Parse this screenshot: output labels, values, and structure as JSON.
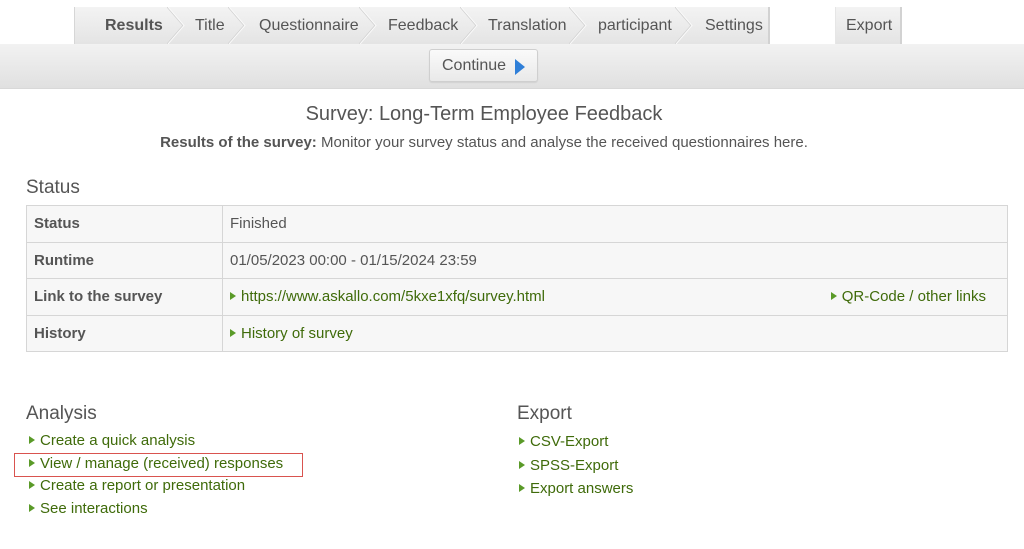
{
  "tabs": [
    {
      "label": "Results",
      "active": true
    },
    {
      "label": "Title"
    },
    {
      "label": "Questionnaire"
    },
    {
      "label": "Feedback"
    },
    {
      "label": "Translation"
    },
    {
      "label": "participant"
    },
    {
      "label": "Settings"
    }
  ],
  "export_tab": {
    "label": "Export"
  },
  "toolbar": {
    "continue_label": "Continue"
  },
  "header": {
    "title": "Survey: Long-Term Employee Feedback",
    "subtitle_bold": "Results of the survey:",
    "subtitle_text": " Monitor your survey status and analyse the received questionnaires here."
  },
  "status": {
    "heading": "Status",
    "rows": [
      {
        "label": "Status",
        "value": "Finished"
      },
      {
        "label": "Runtime",
        "value": "01/05/2023 00:00 - 01/15/2024 23:59"
      },
      {
        "label": "Link to the survey",
        "value": "https://www.askallo.com/5kxe1xfq/survey.html",
        "extra_link": "QR-Code / other links"
      },
      {
        "label": "History",
        "value": "History of survey"
      }
    ]
  },
  "analysis": {
    "heading": "Analysis",
    "links": [
      "Create a quick analysis",
      "View / manage (received) responses",
      "Create a report or presentation",
      "See interactions"
    ],
    "highlighted_index": 1
  },
  "export": {
    "heading": "Export",
    "links": [
      "CSV-Export",
      "SPSS-Export",
      "Export answers"
    ]
  },
  "colors": {
    "link": "#3f6b0a",
    "link_arrow": "#5a9a28",
    "continue_arrow": "#2f7fd8",
    "highlight_border": "#d9534f"
  }
}
